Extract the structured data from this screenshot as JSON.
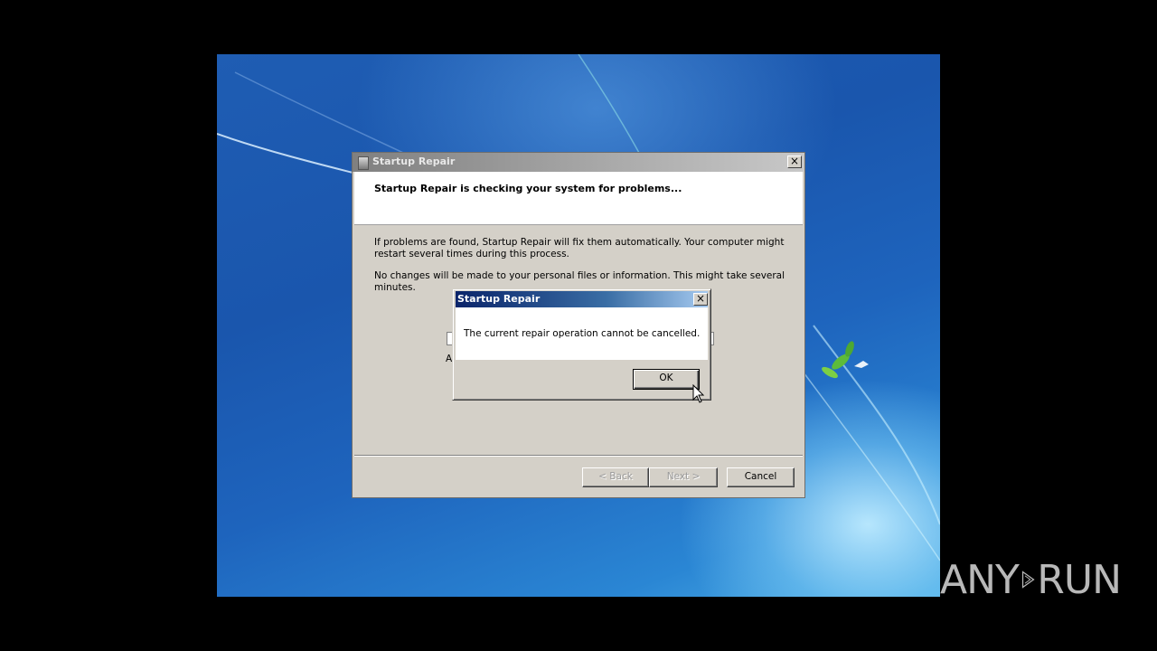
{
  "wizard": {
    "title": "Startup Repair",
    "heading": "Startup Repair is checking your system for problems...",
    "paragraph1": "If problems are found, Startup Repair will fix them automatically. Your computer might restart several times during this process.",
    "paragraph2": "No changes will be made to your personal files or information. This might take several minutes.",
    "status_fragment": "A",
    "back_label": "< Back",
    "next_label": "Next >",
    "cancel_label": "Cancel",
    "close_glyph": "×"
  },
  "dialog": {
    "title": "Startup Repair",
    "message": "The current repair operation cannot be cancelled.",
    "ok_label": "OK",
    "close_glyph": "×"
  },
  "watermark": {
    "left": "ANY",
    "right": "RUN"
  },
  "colors": {
    "desktop_blue": "#1f5db3",
    "dialog_titlebar": "#0a246a",
    "button_face": "#d4d0c8"
  },
  "icons": {
    "wizard_title_icon": "startup-repair-icon",
    "cursor": "arrow-cursor-icon",
    "watermark_play": "play-icon"
  }
}
